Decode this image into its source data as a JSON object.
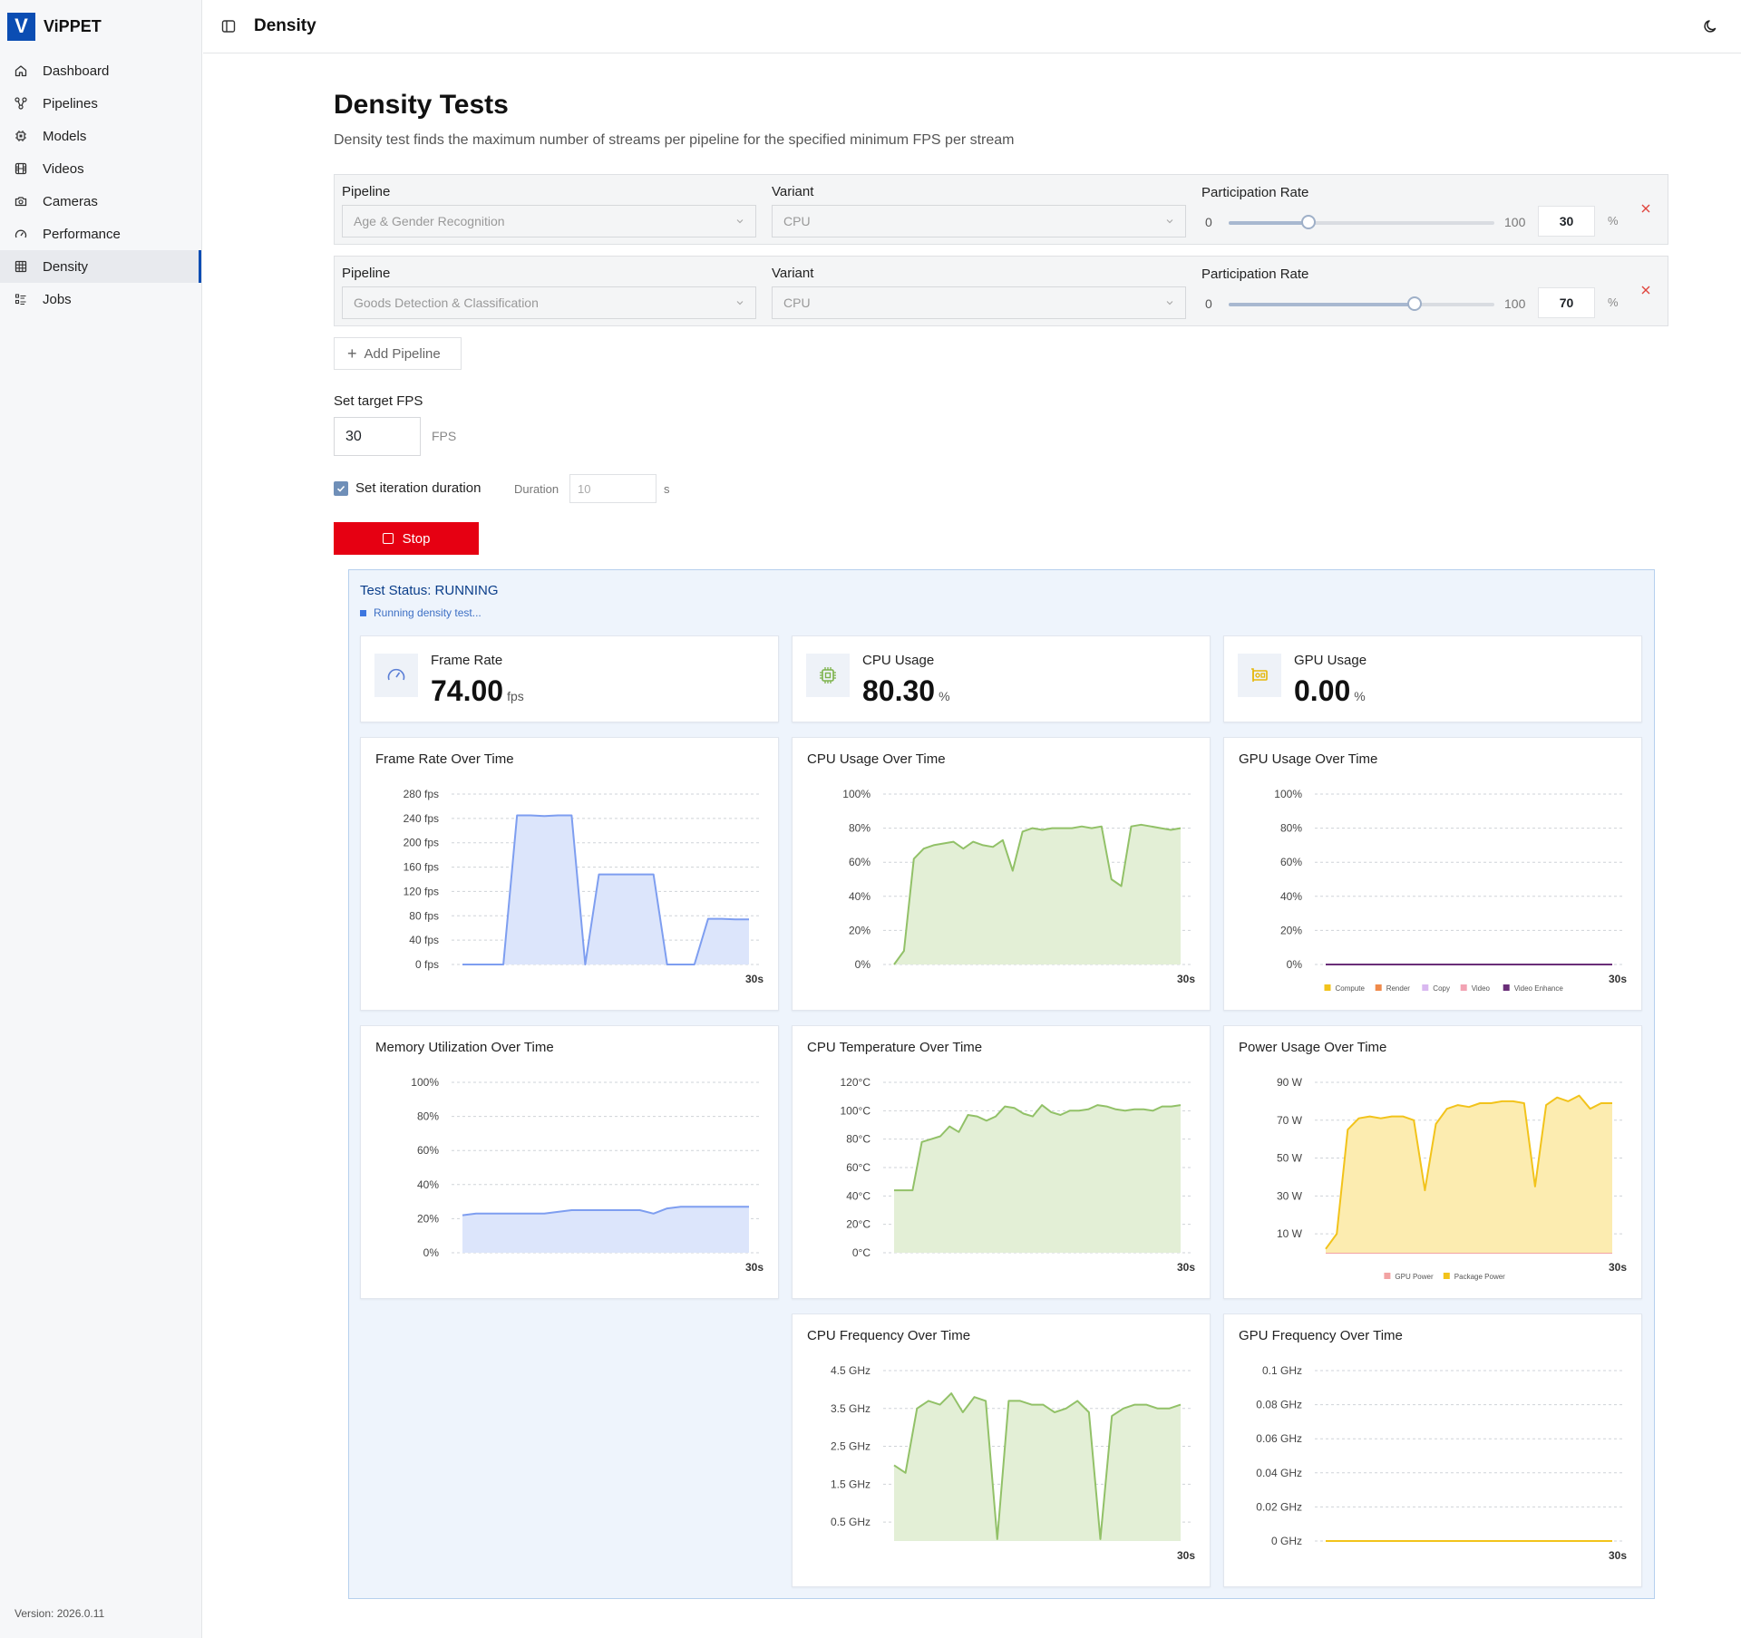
{
  "app": {
    "logo_letter": "V",
    "name": "ViPPET",
    "version": "Version: 2026.0.11"
  },
  "sidebar": {
    "items": [
      {
        "label": "Dashboard",
        "icon": "home-icon"
      },
      {
        "label": "Pipelines",
        "icon": "pipelines-icon"
      },
      {
        "label": "Models",
        "icon": "chip-icon"
      },
      {
        "label": "Videos",
        "icon": "film-icon"
      },
      {
        "label": "Cameras",
        "icon": "camera-icon"
      },
      {
        "label": "Performance",
        "icon": "gauge-icon"
      },
      {
        "label": "Density",
        "icon": "grid-icon",
        "active": true
      },
      {
        "label": "Jobs",
        "icon": "list-icon"
      }
    ]
  },
  "header": {
    "title": "Density"
  },
  "page": {
    "title": "Density Tests",
    "subtitle": "Density test finds the maximum number of streams per pipeline for the specified minimum FPS per stream"
  },
  "pipelines": [
    {
      "pipeline_label": "Pipeline",
      "pipeline_value": "Age & Gender Recognition",
      "variant_label": "Variant",
      "variant_value": "CPU",
      "rate_label": "Participation Rate",
      "min": "0",
      "max": "100",
      "rate": "30",
      "rate_fraction": 0.3,
      "pct": "%"
    },
    {
      "pipeline_label": "Pipeline",
      "pipeline_value": "Goods Detection & Classification",
      "variant_label": "Variant",
      "variant_value": "CPU",
      "rate_label": "Participation Rate",
      "min": "0",
      "max": "100",
      "rate": "70",
      "rate_fraction": 0.7,
      "pct": "%"
    }
  ],
  "controls": {
    "add_pipeline": "Add Pipeline",
    "target_fps_label": "Set target FPS",
    "target_fps_value": "30",
    "fps_unit": "FPS",
    "iteration_label": "Set iteration duration",
    "iteration_checked": true,
    "duration_label": "Duration",
    "duration_placeholder": "10",
    "duration_unit": "s",
    "stop_label": "Stop"
  },
  "status": {
    "title": "Test Status: RUNNING",
    "message": "Running density test..."
  },
  "metrics": [
    {
      "label": "Frame Rate",
      "value": "74.00",
      "unit": "fps",
      "icon": "speedometer-icon",
      "color": "#5b7fd6"
    },
    {
      "label": "CPU Usage",
      "value": "80.30",
      "unit": "%",
      "icon": "cpu-icon",
      "color": "#7cb24a"
    },
    {
      "label": "GPU Usage",
      "value": "0.00",
      "unit": "%",
      "icon": "gpu-icon",
      "color": "#e5b70b"
    }
  ],
  "colors": {
    "blue_line": "#7e9ef0",
    "blue_fill": "#dce5fb",
    "green_line": "#92c168",
    "green_fill": "#e3efd6",
    "yellow_line": "#f2c31b",
    "yellow_fill": "#fcecb0",
    "purple_line": "#6a2e78",
    "pink_line": "#f2a3a3"
  },
  "chart_data": [
    {
      "type": "area",
      "title": "Frame Rate Over Time",
      "x_end_label": "30s",
      "ylim": [
        0,
        280
      ],
      "ticks": [
        "280 fps",
        "240 fps",
        "200 fps",
        "160 fps",
        "120 fps",
        "80 fps",
        "40 fps",
        "0 fps"
      ],
      "tick_values": [
        280,
        240,
        200,
        160,
        120,
        80,
        40,
        0
      ],
      "values": [
        0,
        0,
        0,
        0,
        245,
        245,
        244,
        245,
        245,
        0,
        148,
        148,
        148,
        148,
        148,
        0,
        0,
        0,
        75,
        75,
        74,
        74
      ]
    },
    {
      "type": "area",
      "title": "CPU Usage Over Time",
      "x_end_label": "30s",
      "ylim": [
        0,
        100
      ],
      "ticks": [
        "100%",
        "80%",
        "60%",
        "40%",
        "20%",
        "0%"
      ],
      "tick_values": [
        100,
        80,
        60,
        40,
        20,
        0
      ],
      "values": [
        0,
        8,
        62,
        68,
        70,
        71,
        72,
        68,
        72,
        70,
        69,
        73,
        55,
        78,
        80,
        79,
        80,
        80,
        80,
        81,
        80,
        81,
        50,
        46,
        81,
        82,
        81,
        80,
        79,
        80
      ]
    },
    {
      "type": "line",
      "title": "GPU Usage Over Time",
      "x_end_label": "30s",
      "ylim": [
        0,
        100
      ],
      "ticks": [
        "100%",
        "80%",
        "60%",
        "40%",
        "20%",
        "0%"
      ],
      "tick_values": [
        100,
        80,
        60,
        40,
        20,
        0
      ],
      "series": [
        {
          "name": "Compute",
          "color": "#f2c31b",
          "values": [
            0,
            0
          ]
        },
        {
          "name": "Render",
          "color": "#f08a4b",
          "values": [
            0,
            0
          ]
        },
        {
          "name": "Copy",
          "color": "#d9b8f0",
          "values": [
            0,
            0
          ]
        },
        {
          "name": "Video",
          "color": "#f2a3b3",
          "values": [
            0,
            0
          ]
        },
        {
          "name": "Video Enhance",
          "color": "#6a2e78",
          "values": [
            0,
            0
          ]
        }
      ],
      "legend": "bottom"
    },
    {
      "type": "area",
      "title": "Memory Utilization Over Time",
      "x_end_label": "30s",
      "ylim": [
        0,
        100
      ],
      "ticks": [
        "100%",
        "80%",
        "60%",
        "40%",
        "20%",
        "0%"
      ],
      "tick_values": [
        100,
        80,
        60,
        40,
        20,
        0
      ],
      "values": [
        22,
        23,
        23,
        23,
        23,
        23,
        23,
        24,
        25,
        25,
        25,
        25,
        25,
        25,
        23,
        26,
        27,
        27,
        27,
        27,
        27,
        27
      ]
    },
    {
      "type": "area",
      "title": "CPU Temperature Over Time",
      "x_end_label": "30s",
      "ylim": [
        0,
        120
      ],
      "ticks": [
        "120°C",
        "100°C",
        "80°C",
        "60°C",
        "40°C",
        "20°C",
        "0°C"
      ],
      "tick_values": [
        120,
        100,
        80,
        60,
        40,
        20,
        0
      ],
      "values": [
        44,
        44,
        44,
        78,
        80,
        82,
        89,
        85,
        97,
        96,
        93,
        96,
        103,
        102,
        98,
        96,
        104,
        99,
        97,
        100,
        100,
        101,
        104,
        103,
        101,
        100,
        101,
        101,
        100,
        103,
        103,
        104
      ]
    },
    {
      "type": "area",
      "title": "Power Usage Over Time",
      "x_end_label": "30s",
      "ylim": [
        0,
        90
      ],
      "ticks": [
        "90 W",
        "70 W",
        "50 W",
        "30 W",
        "10 W"
      ],
      "tick_values": [
        90,
        70,
        50,
        30,
        10
      ],
      "series": [
        {
          "name": "GPU Power",
          "color": "#f2a3a3",
          "values": [
            0,
            0
          ]
        },
        {
          "name": "Package Power",
          "color": "#f2c31b",
          "values": [
            2,
            10,
            65,
            71,
            72,
            71,
            72,
            72,
            70,
            33,
            68,
            76,
            78,
            77,
            79,
            79,
            80,
            80,
            79,
            35,
            78,
            82,
            80,
            83,
            76,
            79,
            79
          ]
        }
      ],
      "legend": "bottom"
    },
    {
      "type": "area",
      "title": "CPU Frequency Over Time",
      "x_end_label": "30s",
      "ylim": [
        0,
        4.5
      ],
      "ticks": [
        "4.5 GHz",
        "3.5 GHz",
        "2.5 GHz",
        "1.5 GHz",
        "0.5 GHz"
      ],
      "tick_values": [
        4.5,
        3.5,
        2.5,
        1.5,
        0.5
      ],
      "values": [
        2.0,
        1.8,
        3.5,
        3.7,
        3.6,
        3.9,
        3.4,
        3.8,
        3.7,
        0.05,
        3.7,
        3.7,
        3.6,
        3.6,
        3.4,
        3.5,
        3.7,
        3.4,
        0.05,
        3.3,
        3.5,
        3.6,
        3.6,
        3.5,
        3.5,
        3.6
      ]
    },
    {
      "type": "line",
      "title": "GPU Frequency Over Time",
      "x_end_label": "30s",
      "ylim": [
        0,
        0.1
      ],
      "ticks": [
        "0.1 GHz",
        "0.08 GHz",
        "0.06 GHz",
        "0.04 GHz",
        "0.02 GHz",
        "0 GHz"
      ],
      "tick_values": [
        0.1,
        0.08,
        0.06,
        0.04,
        0.02,
        0
      ],
      "values": [
        0,
        0
      ]
    }
  ]
}
